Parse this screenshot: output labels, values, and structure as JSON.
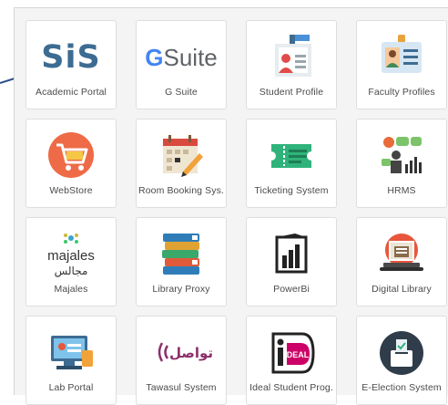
{
  "tiles": [
    {
      "label": "Academic Portal",
      "icon": "sis-logo-icon",
      "logo_text": "SiS"
    },
    {
      "label": "G Suite",
      "icon": "gsuite-logo-icon",
      "logo_text": "G Suite"
    },
    {
      "label": "Student Profile",
      "icon": "student-profile-icon"
    },
    {
      "label": "Faculty Profiles",
      "icon": "faculty-id-card-icon"
    },
    {
      "label": "WebStore",
      "icon": "shopping-cart-icon"
    },
    {
      "label": "Room Booking Sys.",
      "icon": "calendar-pencil-icon"
    },
    {
      "label": "Ticketing System",
      "icon": "ticket-icon"
    },
    {
      "label": "HRMS",
      "icon": "hr-chart-icon"
    },
    {
      "label": "Majales",
      "icon": "majales-logo-icon",
      "logo_text": "majales مجالس"
    },
    {
      "label": "Library Proxy",
      "icon": "books-stack-icon"
    },
    {
      "label": "PowerBi",
      "icon": "powerbi-logo-icon"
    },
    {
      "label": "Digital Library",
      "icon": "laptop-book-icon"
    },
    {
      "label": "Lab Portal",
      "icon": "computer-lab-icon"
    },
    {
      "label": "Tawasul System",
      "icon": "tawasul-logo-icon",
      "logo_text": "تواصل"
    },
    {
      "label": "Ideal Student Prog.",
      "icon": "ideal-logo-icon",
      "logo_text": "iDEAL"
    },
    {
      "label": "E-Election System",
      "icon": "ballot-box-icon"
    }
  ],
  "colors": {
    "panel": "#f4f4f4",
    "tile_border": "#dedede",
    "label": "#4a4a4a",
    "arrow": "#2b4e8c"
  }
}
